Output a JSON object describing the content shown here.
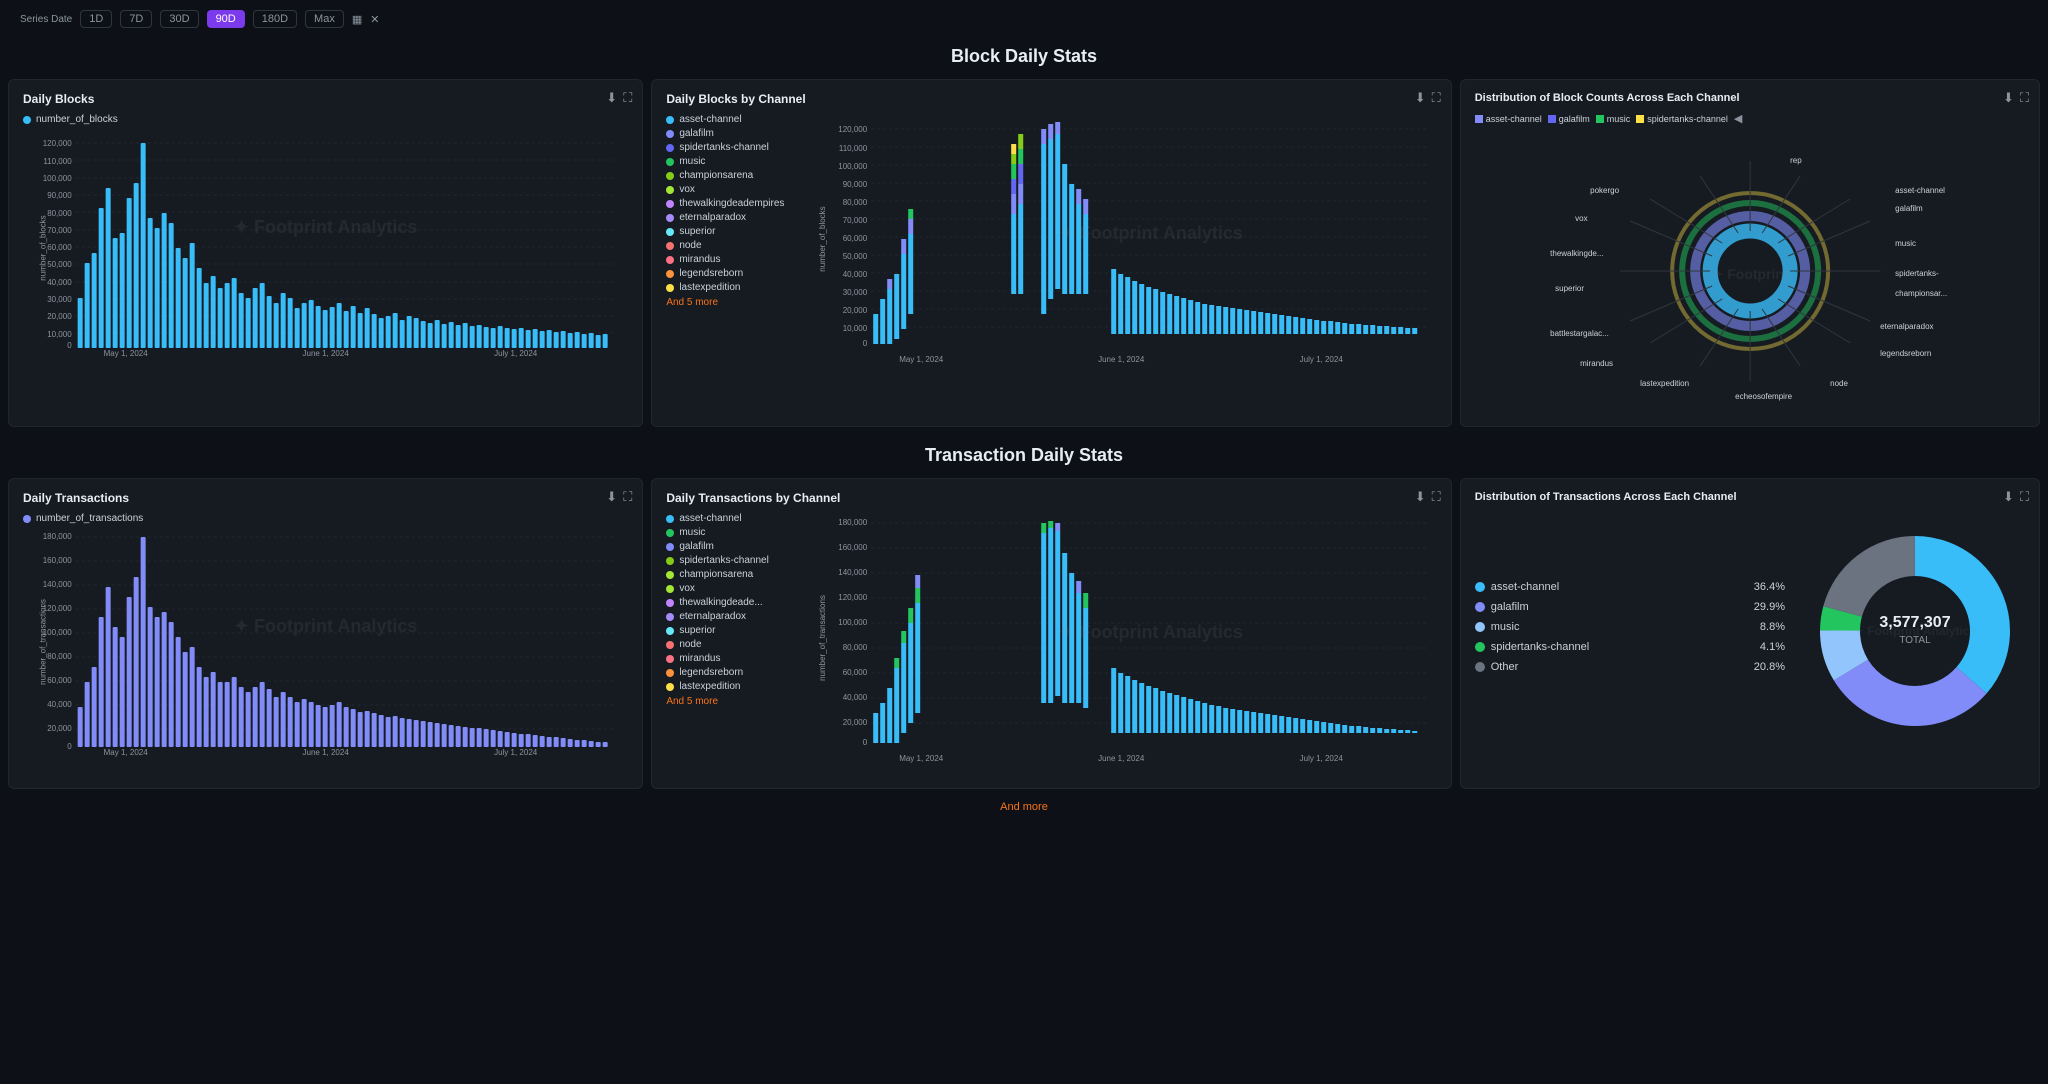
{
  "header": {
    "series_date_label": "Series Date",
    "date_buttons": [
      "1D",
      "7D",
      "30D",
      "90D",
      "180D",
      "Max"
    ],
    "active_button": "90D"
  },
  "section1_title": "Block Daily Stats",
  "section2_title": "Transaction Daily Stats",
  "panels": {
    "daily_blocks": {
      "title": "Daily Blocks",
      "legend": [
        {
          "label": "number_of_blocks",
          "color": "#38bdf8",
          "type": "dot"
        }
      ],
      "y_label": "number_of_blocks",
      "x_labels": [
        "May 1, 2024",
        "June 1, 2024",
        "July 1, 2024"
      ],
      "y_ticks": [
        "120,000",
        "110,000",
        "100,000",
        "90,000",
        "80,000",
        "70,000",
        "60,000",
        "50,000",
        "40,000",
        "30,000",
        "20,000",
        "10,000",
        "0"
      ]
    },
    "daily_blocks_by_channel": {
      "title": "Daily Blocks by Channel",
      "legend": [
        {
          "label": "asset-channel",
          "color": "#38bdf8",
          "type": "dot"
        },
        {
          "label": "galafilm",
          "color": "#818cf8",
          "type": "dot"
        },
        {
          "label": "spidertanks-channel",
          "color": "#6366f1",
          "type": "dot"
        },
        {
          "label": "music",
          "color": "#22c55e",
          "type": "dot"
        },
        {
          "label": "championsarena",
          "color": "#84cc16",
          "type": "dot"
        },
        {
          "label": "vox",
          "color": "#a3e635",
          "type": "dot"
        },
        {
          "label": "thewalkingdeadempires",
          "color": "#c084fc",
          "type": "dot"
        },
        {
          "label": "eternalparadox",
          "color": "#a78bfa",
          "type": "dot"
        },
        {
          "label": "superior",
          "color": "#67e8f9",
          "type": "dot"
        },
        {
          "label": "node",
          "color": "#f87171",
          "type": "dot"
        },
        {
          "label": "mirandus",
          "color": "#fb7185",
          "type": "dot"
        },
        {
          "label": "legendsreborn",
          "color": "#fb923c",
          "type": "dot"
        },
        {
          "label": "lastexpedition",
          "color": "#fde047",
          "type": "dot"
        }
      ],
      "more_link": "And 5 more",
      "y_label": "number_of_blocks",
      "y_ticks": [
        "120,000",
        "110,000",
        "100,000",
        "90,000",
        "80,000",
        "70,000",
        "60,000",
        "50,000",
        "40,000",
        "30,000",
        "20,000",
        "10,000",
        "0"
      ],
      "x_labels": [
        "May 1, 2024",
        "June 1, 2024",
        "July 1, 2024"
      ]
    },
    "distribution_blocks": {
      "title": "Distribution of Block Counts Across Each Channel",
      "legend_chips": [
        {
          "label": "asset-channel",
          "color": "#818cf8"
        },
        {
          "label": "galafilm",
          "color": "#6366f1"
        },
        {
          "label": "music",
          "color": "#22c55e"
        },
        {
          "label": "spidertanks-channel",
          "color": "#fde047"
        }
      ],
      "spoke_labels": [
        "rep",
        "asset-channel",
        "galafilm",
        "music",
        "spidertanks-",
        "championsар...",
        "eternalparadox",
        "legendsreborn",
        "node",
        "echeosofempire",
        "lastexpedition",
        "mirandus",
        "battlestargalac...",
        "superior",
        "thewalkingde...",
        "vox",
        "pokergo"
      ]
    },
    "daily_transactions": {
      "title": "Daily Transactions",
      "legend": [
        {
          "label": "number_of_transactions",
          "color": "#818cf8",
          "type": "dot"
        }
      ],
      "y_label": "number_of_transactions",
      "x_labels": [
        "May 1, 2024",
        "June 1, 2024",
        "July 1, 2024"
      ],
      "y_ticks": [
        "180,000",
        "160,000",
        "140,000",
        "120,000",
        "100,000",
        "80,000",
        "60,000",
        "40,000",
        "20,000",
        "0"
      ]
    },
    "daily_transactions_by_channel": {
      "title": "Daily Transactions by Channel",
      "legend": [
        {
          "label": "asset-channel",
          "color": "#38bdf8",
          "type": "dot"
        },
        {
          "label": "music",
          "color": "#22c55e",
          "type": "dot"
        },
        {
          "label": "galafilm",
          "color": "#818cf8",
          "type": "dot"
        },
        {
          "label": "spidertanks-channel",
          "color": "#84cc16",
          "type": "dot"
        },
        {
          "label": "championsarena",
          "color": "#a3e635",
          "type": "dot"
        },
        {
          "label": "vox",
          "color": "#a3e635",
          "type": "dot"
        },
        {
          "label": "thewalkingdeade...",
          "color": "#c084fc",
          "type": "dot"
        },
        {
          "label": "eternalparadox",
          "color": "#a78bfa",
          "type": "dot"
        },
        {
          "label": "superior",
          "color": "#67e8f9",
          "type": "dot"
        },
        {
          "label": "node",
          "color": "#f87171",
          "type": "dot"
        },
        {
          "label": "mirandus",
          "color": "#fb7185",
          "type": "dot"
        },
        {
          "label": "legendsreborn",
          "color": "#fb923c",
          "type": "dot"
        },
        {
          "label": "lastexpedition",
          "color": "#fde047",
          "type": "dot"
        }
      ],
      "more_link": "And 5 more",
      "y_label": "number_of_transactions",
      "y_ticks": [
        "180,000",
        "160,000",
        "140,000",
        "120,000",
        "100,000",
        "80,000",
        "60,000",
        "40,000",
        "20,000",
        "0"
      ],
      "x_labels": [
        "May 1, 2024",
        "June 1, 2024",
        "July 1, 2024"
      ]
    },
    "distribution_transactions": {
      "title": "Distribution of Transactions Across Each Channel",
      "legend": [
        {
          "label": "asset-channel",
          "color": "#38bdf8",
          "pct": "36.4%"
        },
        {
          "label": "galafilm",
          "color": "#818cf8",
          "pct": "29.9%"
        },
        {
          "label": "music",
          "color": "#93c5fd",
          "pct": "8.8%"
        },
        {
          "label": "spidertanks-channel",
          "color": "#22c55e",
          "pct": "4.1%"
        },
        {
          "label": "Other",
          "color": "#6b7280",
          "pct": "20.8%"
        }
      ],
      "total": "3,577,307",
      "total_label": "TOTAL"
    }
  }
}
